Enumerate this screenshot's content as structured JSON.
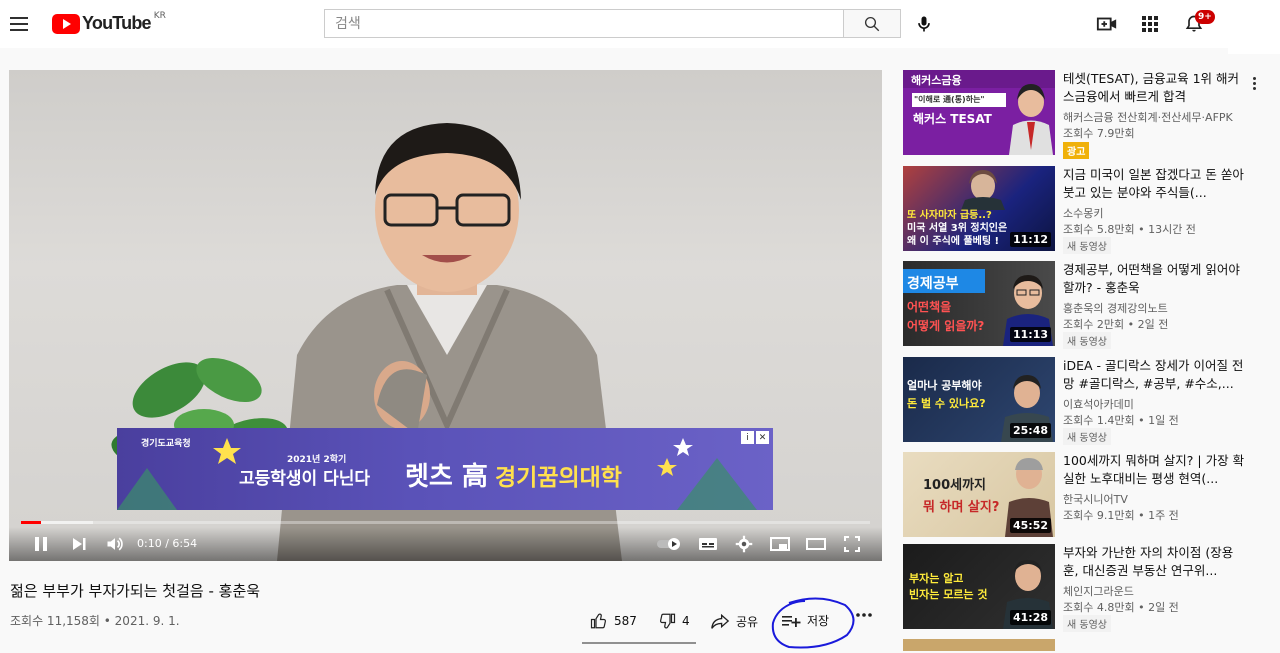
{
  "header": {
    "logo_text": "YouTube",
    "region": "KR",
    "search_placeholder": "검색",
    "notification_count": "9+",
    "icons": [
      "menu-icon",
      "search-icon",
      "mic-icon",
      "create-video-icon",
      "apps-icon",
      "bell-icon"
    ]
  },
  "player": {
    "current_time": "0:10",
    "duration": "6:54",
    "time_display": "0:10 / 6:54",
    "progress_played": 0.024,
    "progress_buffered": 0.085,
    "ad": {
      "logo": "경기도교육청",
      "sub": "2021년 2학기",
      "main": "고등학생이 다닌다",
      "mid": "렛츠 高",
      "right": "경기꿈의대학",
      "close": "✕",
      "info": "i"
    }
  },
  "video": {
    "title": "젊은 부부가 부자가되는 첫걸음 - 홍춘욱",
    "views": "조회수 11,158회",
    "date": "2021. 9. 1.",
    "meta": "조회수 11,158회 • 2021. 9. 1.",
    "likes": "587",
    "dislikes": "4",
    "share_label": "공유",
    "save_label": "저장"
  },
  "recommendations": [
    {
      "title": "테셋(TESAT), 금융교육 1위 해커스금융에서 빠르게 합격",
      "channel": "해커스금융 전산회계·전산세무·AFPK",
      "views": "조회수 7.9만회",
      "badge": "광고",
      "thumb_texts": [
        "해커스금융",
        "\"이해로 通(통)하는\"",
        "해커스 TESAT"
      ]
    },
    {
      "title": "지금 미국이 일본 잡겠다고 돈 쏟아붓고 있는 분야와 주식들(...",
      "channel": "소수몽키",
      "views": "조회수 5.8만회 • 13시간 전",
      "badge": "새 동영상",
      "duration": "11:12",
      "thumb_texts": [
        "또 사자마자 급등..?",
        "미국 서열 3위 정치인은",
        "왜 이 주식에 풀베팅 !"
      ]
    },
    {
      "title": "경제공부, 어떤책을 어떻게 읽어야할까? - 홍춘욱",
      "channel": "홍춘욱의 경제강의노트",
      "views": "조회수 2만회 • 2일 전",
      "badge": "새 동영상",
      "duration": "11:13",
      "thumb_texts": [
        "경제공부",
        "어떤책을",
        "어떻게 읽을까?"
      ]
    },
    {
      "title": "iDEA - 골디락스 장세가 이어질 전망 #골디락스, #공부, #수소,...",
      "channel": "이효석아카데미",
      "views": "조회수 1.4만회 • 1일 전",
      "badge": "새 동영상",
      "duration": "25:48",
      "thumb_texts": [
        "얼마나 공부해야",
        "돈 벌 수 있나요?"
      ]
    },
    {
      "title": "100세까지 뭐하며 살지? | 가장 확실한 노후대비는 평생 현역(...",
      "channel": "한국시니어TV",
      "views": "조회수 9.1만회 • 1주 전",
      "duration": "45:52",
      "thumb_texts": [
        "100세까지",
        "뭐 하며 살지?"
      ]
    },
    {
      "title": "부자와 가난한 자의 차이점 (장용훈, 대신증권 부동산 연구위...",
      "channel": "체인지그라운드",
      "views": "조회수 4.8만회 • 2일 전",
      "badge": "새 동영상",
      "duration": "41:28",
      "thumb_texts": [
        "부자는 알고",
        "빈자는 모르는 것"
      ]
    }
  ],
  "colors": {
    "brand_red": "#ff0000",
    "progress_red": "#ff0000",
    "ad_badge": "#f0b10a",
    "text_primary": "#0f0f0f",
    "text_secondary": "#606060",
    "annotation_blue": "#1a1adb"
  }
}
